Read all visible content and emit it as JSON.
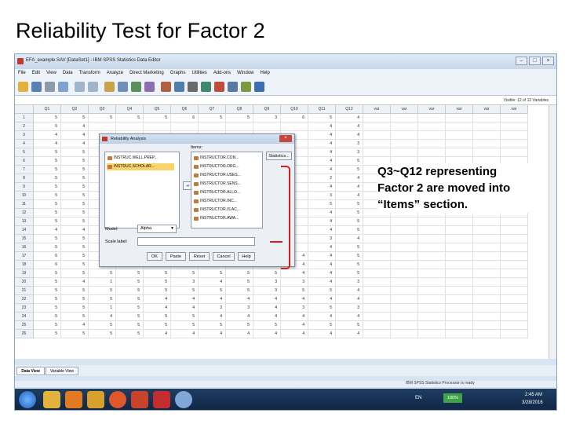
{
  "slide": {
    "title": "Reliability Test for Factor 2",
    "callout": "Q3~Q12 representing Factor 2 are moved into “Items” section."
  },
  "window": {
    "title": "EFA_example.SAV [DataSet1] - IBM SPSS Statistics Data Editor"
  },
  "menu": [
    "File",
    "Edit",
    "View",
    "Data",
    "Transform",
    "Analyze",
    "Direct Marketing",
    "Graphs",
    "Utilities",
    "Add-ons",
    "Window",
    "Help"
  ],
  "visible_info": "Visible: 12 of 12 Variables",
  "grid": {
    "columns": [
      "Q1",
      "Q2",
      "Q3",
      "Q4",
      "Q5",
      "Q6",
      "Q7",
      "Q8",
      "Q9",
      "Q10",
      "Q11",
      "Q12",
      "var",
      "var",
      "var",
      "var",
      "var",
      "var"
    ],
    "rows": [
      [
        "1",
        "5",
        "5",
        "5",
        "5",
        "5",
        "6",
        "5",
        "5",
        "3",
        "6",
        "5",
        "4"
      ],
      [
        "2",
        "5",
        "4",
        "",
        "",
        "",
        "",
        "",
        "",
        "",
        "",
        "4",
        "4"
      ],
      [
        "3",
        "4",
        "4",
        "",
        "",
        "",
        "",
        "",
        "",
        "",
        "",
        "4",
        "4"
      ],
      [
        "4",
        "4",
        "4",
        "",
        "",
        "",
        "",
        "",
        "",
        "",
        "",
        "4",
        "3"
      ],
      [
        "5",
        "5",
        "5",
        "",
        "",
        "",
        "",
        "",
        "",
        "",
        "",
        "4",
        "3"
      ],
      [
        "6",
        "5",
        "5",
        "",
        "",
        "",
        "",
        "",
        "",
        "",
        "",
        "4",
        "5"
      ],
      [
        "7",
        "5",
        "5",
        "",
        "",
        "",
        "",
        "",
        "",
        "",
        "",
        "4",
        "5"
      ],
      [
        "8",
        "5",
        "5",
        "",
        "",
        "",
        "",
        "",
        "",
        "",
        "",
        "2",
        "4"
      ],
      [
        "9",
        "5",
        "5",
        "",
        "",
        "",
        "",
        "",
        "",
        "",
        "",
        "4",
        "4"
      ],
      [
        "10",
        "5",
        "5",
        "",
        "",
        "",
        "",
        "",
        "",
        "",
        "",
        "3",
        "4"
      ],
      [
        "11",
        "5",
        "5",
        "",
        "",
        "",
        "",
        "",
        "",
        "",
        "",
        "5",
        "5"
      ],
      [
        "12",
        "5",
        "5",
        "",
        "",
        "",
        "",
        "",
        "",
        "",
        "",
        "4",
        "5"
      ],
      [
        "13",
        "5",
        "5",
        "",
        "",
        "",
        "",
        "",
        "",
        "",
        "",
        "4",
        "5"
      ],
      [
        "14",
        "4",
        "4",
        "",
        "",
        "",
        "",
        "",
        "",
        "",
        "",
        "4",
        "5"
      ],
      [
        "15",
        "5",
        "5",
        "",
        "",
        "",
        "",
        "",
        "",
        "",
        "",
        "3",
        "4"
      ],
      [
        "16",
        "5",
        "5",
        "",
        "",
        "",
        "",
        "",
        "",
        "",
        "",
        "4",
        "5"
      ],
      [
        "17",
        "6",
        "5",
        "5",
        "5",
        "5",
        "5",
        "4",
        "4",
        "4",
        "4",
        "4",
        "5"
      ],
      [
        "18",
        "6",
        "5",
        "5",
        "5",
        "5",
        "5",
        "5",
        "5",
        "4",
        "4",
        "4",
        "5"
      ],
      [
        "19",
        "5",
        "5",
        "5",
        "5",
        "5",
        "5",
        "5",
        "5",
        "5",
        "4",
        "4",
        "5"
      ],
      [
        "20",
        "5",
        "4",
        "1",
        "5",
        "5",
        "3",
        "4",
        "5",
        "3",
        "3",
        "4",
        "3"
      ],
      [
        "21",
        "5",
        "5",
        "5",
        "5",
        "5",
        "5",
        "5",
        "5",
        "3",
        "5",
        "5",
        "4"
      ],
      [
        "22",
        "5",
        "5",
        "5",
        "5",
        "4",
        "4",
        "4",
        "4",
        "4",
        "4",
        "4",
        "4"
      ],
      [
        "23",
        "5",
        "5",
        "1",
        "5",
        "4",
        "4",
        "3",
        "3",
        "4",
        "3",
        "5",
        "3"
      ],
      [
        "24",
        "5",
        "5",
        "4",
        "5",
        "5",
        "5",
        "4",
        "4",
        "4",
        "4",
        "4",
        "4"
      ],
      [
        "25",
        "5",
        "4",
        "5",
        "5",
        "5",
        "5",
        "5",
        "5",
        "5",
        "4",
        "5",
        "5"
      ],
      [
        "26",
        "5",
        "5",
        "5",
        "5",
        "4",
        "4",
        "4",
        "4",
        "4",
        "4",
        "4",
        "4"
      ]
    ]
  },
  "tabs": {
    "data_view": "Data View",
    "variable_view": "Variable View"
  },
  "statusbar": "IBM SPSS Statistics Processor is ready",
  "dialog": {
    "title": "Reliability Analysis",
    "items_label": "Items:",
    "statistics_button": "Statistics...",
    "left_items": [
      "INSTRUC.WELL.PREP...",
      "INSTRUC.SCHOLAR..."
    ],
    "right_items": [
      "INSTRUCTOR.CON...",
      "INSTRUCTOR.ORG...",
      "INSTRUCTOR.USES...",
      "INSTRUCTOR.SENS...",
      "INSTRUCTOR.ALLO...",
      "INSTRUCTOR.INC...",
      "INSTRUCTOR.IS AC...",
      "INSTRUCTOR.AWA..."
    ],
    "model_label": "Model:",
    "model_value": "Alpha",
    "scale_label": "Scale label:",
    "buttons": {
      "ok": "OK",
      "paste": "Paste",
      "reset": "Reset",
      "cancel": "Cancel",
      "help": "Help"
    }
  },
  "taskbar": {
    "lang": "EN",
    "zoom": "100%",
    "time": "2:45 AM",
    "date": "3/28/2016"
  }
}
